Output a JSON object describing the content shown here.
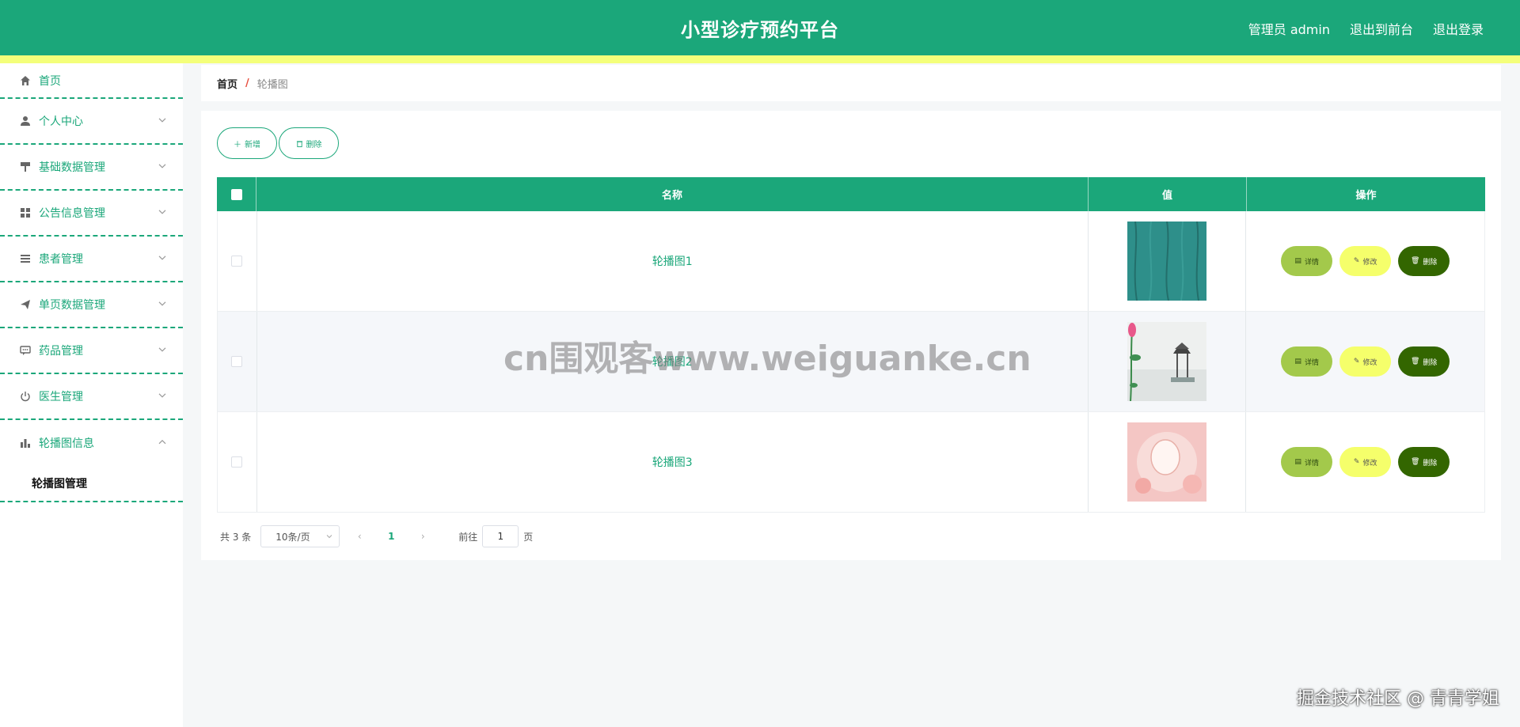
{
  "header": {
    "title": "小型诊疗预约平台",
    "links": [
      "管理员 admin",
      "退出到前台",
      "退出登录"
    ],
    "bg_color": "#1ba77a",
    "accent_bar_color": "#f4ff7a"
  },
  "sidebar": {
    "items": [
      {
        "label": "首页",
        "icon": "home-icon"
      },
      {
        "label": "个人中心",
        "icon": "user-icon"
      },
      {
        "label": "基础数据管理",
        "icon": "paint-roller-icon"
      },
      {
        "label": "公告信息管理",
        "icon": "grid-icon"
      },
      {
        "label": "患者管理",
        "icon": "list-icon"
      },
      {
        "label": "单页数据管理",
        "icon": "send-icon"
      },
      {
        "label": "药品管理",
        "icon": "chat-icon"
      },
      {
        "label": "医生管理",
        "icon": "power-icon"
      },
      {
        "label": "轮播图信息",
        "icon": "bar-chart-icon"
      }
    ],
    "submenu": {
      "label": "轮播图管理"
    }
  },
  "breadcrumb": {
    "home": "首页",
    "separator": "/",
    "current": "轮播图"
  },
  "toolbar": {
    "add_label": "新增",
    "delete_label": "删除"
  },
  "table": {
    "columns": [
      "名称",
      "值",
      "操作"
    ],
    "rows": [
      {
        "name": "轮播图1",
        "image": "teal-wood-texture"
      },
      {
        "name": "轮播图2",
        "image": "lotus-pavilion-painting"
      },
      {
        "name": "轮播图3",
        "image": "pink-floral-mirror"
      }
    ],
    "row_actions": {
      "detail": "详情",
      "edit": "修改",
      "delete": "删除"
    }
  },
  "pagination": {
    "total": "共 3 条",
    "page_size": "10条/页",
    "current_page": "1",
    "goto_prefix": "前往",
    "goto_value": "1",
    "goto_suffix": "页"
  },
  "watermarks": {
    "center": "cn围观客www.weiguanke.cn",
    "corner": "掘金技术社区 @ 青青学姐"
  }
}
